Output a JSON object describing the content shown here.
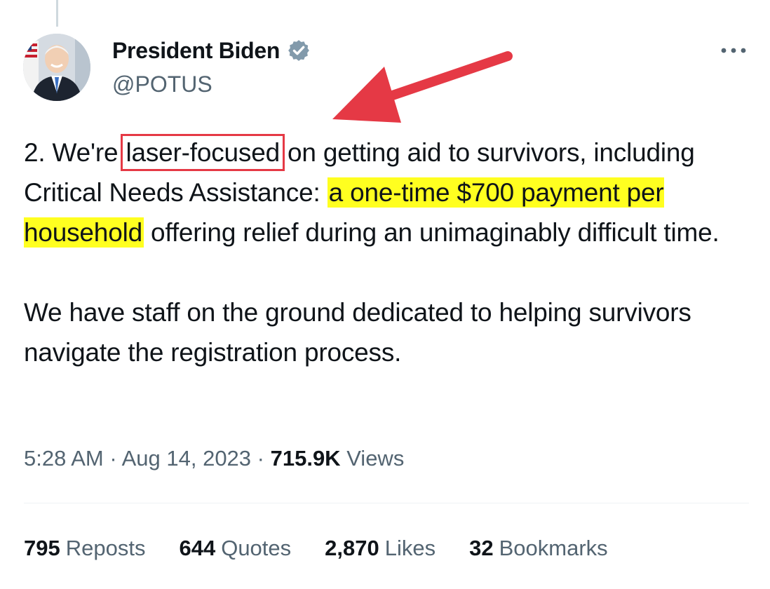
{
  "author": {
    "display_name": "President Biden",
    "handle": "@POTUS",
    "avatar_icon": "portrait-avatar",
    "verified_icon": "verified-badge-icon"
  },
  "tweet": {
    "p1_part1": "2. We're",
    "p1_boxed": "laser-focused",
    "p1_part2": " on getting aid to survivors, including Critical Needs Assistance: ",
    "p1_highlight": "a one-time $700 payment per household",
    "p1_part3": " offering relief during an unimaginably difficult time.",
    "p2": "We have staff on the ground dedicated to helping survivors navigate the registration process."
  },
  "meta": {
    "time": "5:28 AM",
    "sep1": " · ",
    "date": "Aug 14, 2023",
    "sep2": " · ",
    "views_count": "715.9K",
    "views_label": " Views"
  },
  "stats": {
    "reposts_count": "795",
    "reposts_label": "Reposts",
    "quotes_count": "644",
    "quotes_label": "Quotes",
    "likes_count": "2,870",
    "likes_label": "Likes",
    "bookmarks_count": "32",
    "bookmarks_label": "Bookmarks"
  },
  "annotations": {
    "arrow_color": "#e53945",
    "box_color": "#e53945",
    "highlight_color": "#ffff20"
  },
  "colors": {
    "text": "#0f1419",
    "secondary": "#536471",
    "verified": "#829aab"
  }
}
